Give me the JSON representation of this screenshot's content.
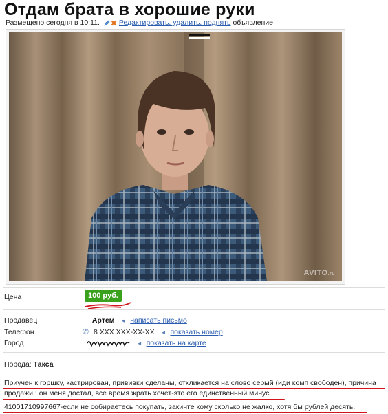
{
  "page": {
    "title": "Отдам брата в хорошие руки",
    "posted": "Размещено сегодня в 10:11.",
    "edit_links": "Редактировать, удалить, поднять",
    "edit_suffix": "объявление"
  },
  "photo": {
    "watermark": "AVITO",
    "watermark_suffix": ".ru"
  },
  "details": {
    "price_label": "Цена",
    "price_value": "100 руб.",
    "seller_label": "Продавец",
    "seller_name": "Артём",
    "write_letter": "написать письмо",
    "phone_label": "Телефон",
    "phone_value": "8 XXX XXX-XX-XX",
    "show_number": "показать номер",
    "city_label": "Город",
    "show_map": "показать на карте"
  },
  "breed": {
    "label": "Порода:",
    "value": "Такса"
  },
  "description": {
    "line1": "Приучен к горшку, кастрирован, прививки сделаны, откликается на слово серый (иди комп свободен), причина",
    "line2": "продажи : он меня достал, все время жрать хочет-это его единственный минус.",
    "line3": "41001710997667-если не собираетесь покупать, закинте кому сколько не жалко, хотя бы рублей десять."
  },
  "colors": {
    "link": "#2a5db0",
    "price_badge": "#3aa11d",
    "annotation": "#d2141c"
  }
}
